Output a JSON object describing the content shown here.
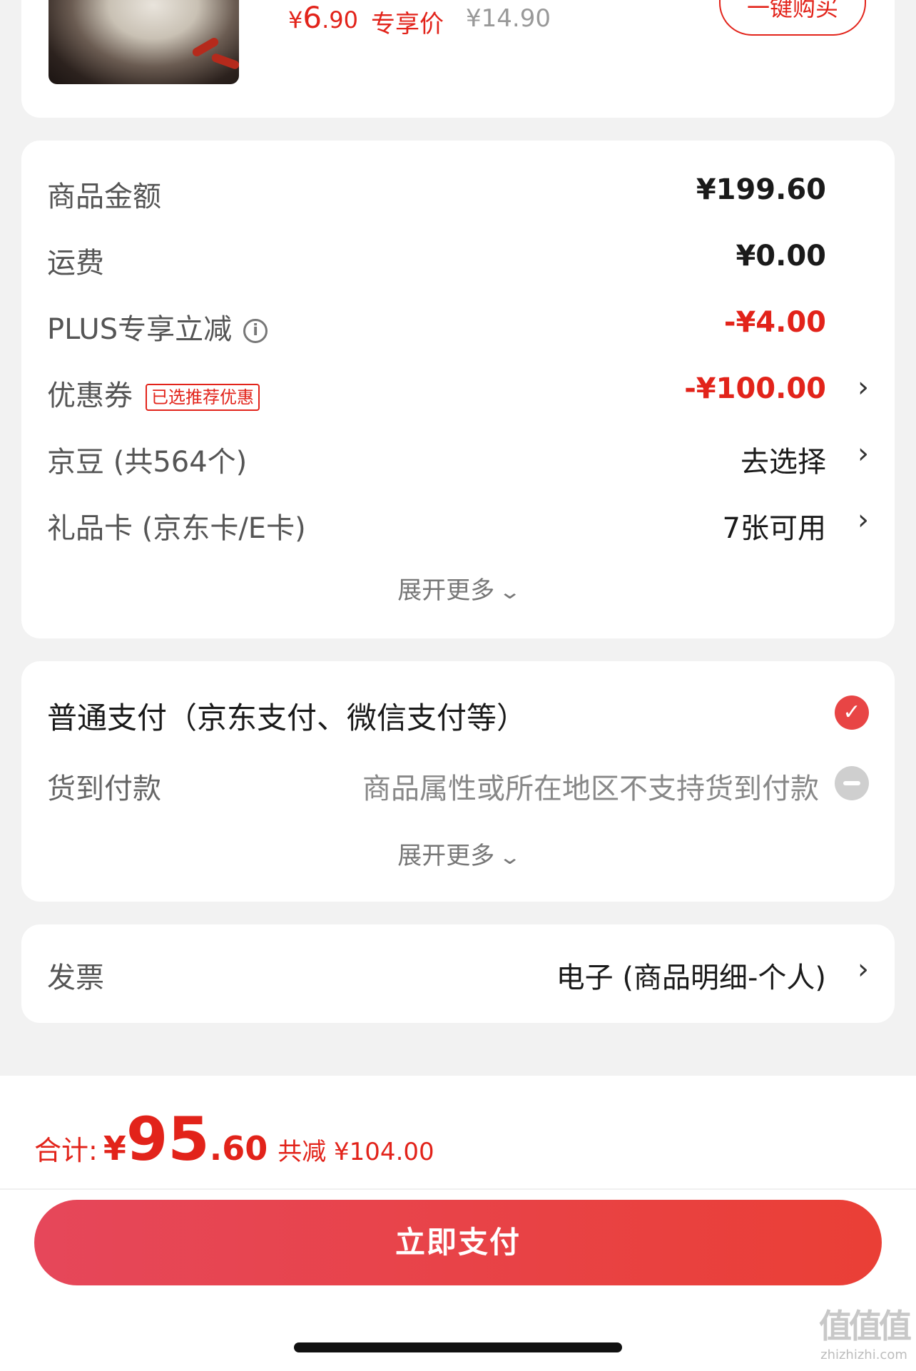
{
  "product": {
    "promo_price_yen": "¥",
    "promo_price_int": "6",
    "promo_price_dec": ".90",
    "promo_tag": "专享价",
    "original_price": "¥14.90",
    "buy_button": "一键购买"
  },
  "summary": {
    "rows": [
      {
        "label": "商品金额",
        "value": "¥199.60"
      },
      {
        "label": "运费",
        "value": "¥0.00"
      },
      {
        "label": "PLUS专享立减",
        "value": "-¥4.00"
      },
      {
        "label": "优惠券",
        "badge": "已选推荐优惠",
        "value": "-¥100.00"
      },
      {
        "label": "京豆 (共564个)",
        "value": "去选择"
      },
      {
        "label": "礼品卡 (京东卡/E卡)",
        "value": "7张可用"
      }
    ],
    "expand_label": "展开更多"
  },
  "payment": {
    "normal_title": "普通支付（京东支付、微信支付等）",
    "cod_label": "货到付款",
    "cod_note": "商品属性或所在地区不支持货到付款",
    "expand_label": "展开更多"
  },
  "invoice": {
    "label": "发票",
    "value": "电子 (商品明细-个人)"
  },
  "footer": {
    "total_label": "合计:",
    "total_yen": "¥",
    "total_int": "95",
    "total_dec": ".60",
    "total_saving": "共减 ¥104.00",
    "pay_button": "立即支付"
  },
  "watermark": {
    "big": "值值值",
    "small": "zhizhizhi.com"
  },
  "colors": {
    "accent": "#e2231a",
    "pay_button_start": "#e6475a",
    "pay_button_end": "#ea3f36"
  }
}
